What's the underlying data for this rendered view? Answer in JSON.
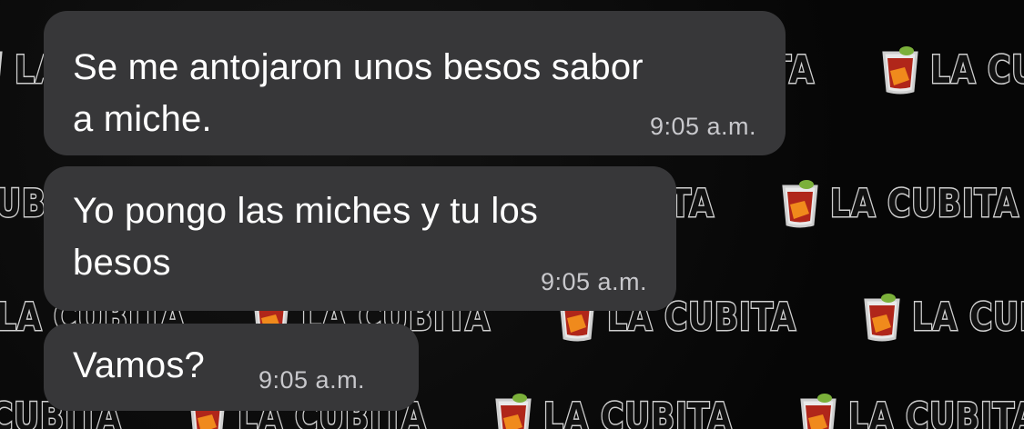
{
  "chat": {
    "background": {
      "wallpaper_text": "La Cubita",
      "colors": {
        "base": "#0a0a0a",
        "logo_outline": "#cfcfcf",
        "glass_red": "#b0261a",
        "glass_orange": "#f08a1c",
        "leaf_green": "#7bb03a"
      }
    },
    "messages": [
      {
        "text_line_1": "Se me antojaron unos besos sabor",
        "text_line_2": "a miche.",
        "time": "9:05 a.m."
      },
      {
        "text_line_1": "Yo pongo las miches y tu los",
        "text_line_2": "besos",
        "time": "9:05 a.m."
      },
      {
        "text_line_1": "Vamos?",
        "time": "9:05 a.m."
      }
    ],
    "bubble_color": "#373739",
    "text_color": "#ffffff",
    "time_color": "#c8c8cc"
  }
}
